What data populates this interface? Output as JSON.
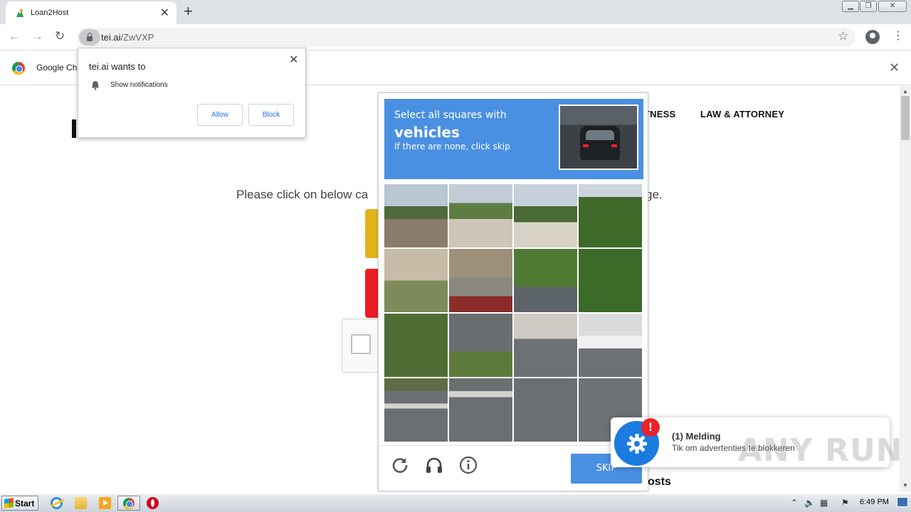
{
  "browser": {
    "tab_title": "Loan2Host",
    "url_host": "tei.ai",
    "url_path": "/ZwVXP",
    "infobar_text": "Google Ch"
  },
  "permission_prompt": {
    "title": "tei.ai wants to",
    "permission": "Show notifications",
    "allow_label": "Allow",
    "block_label": "Block"
  },
  "page": {
    "nav": [
      "TNESS",
      "LAW & ATTORNEY"
    ],
    "instruction_start": "Please click on below ca",
    "instruction_end": "ge.",
    "posts_fragment": "osts"
  },
  "captcha": {
    "line1": "Select all squares with",
    "line2": "vehicles",
    "line3": "If there are none, click skip",
    "skip_label": "SKIP",
    "colors": {
      "header": "#4a90e2",
      "button": "#4a90e2"
    }
  },
  "toast": {
    "badge": "!",
    "title": "(1) Melding",
    "body": "Tik om advertenties te blokkeren"
  },
  "watermark": "ANY RUN",
  "taskbar": {
    "start_label": "Start",
    "clock": "6:49 PM"
  }
}
